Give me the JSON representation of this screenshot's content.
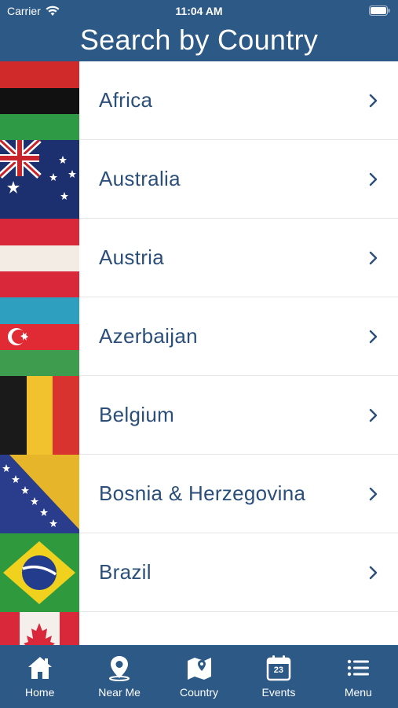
{
  "status_bar": {
    "carrier": "Carrier",
    "time": "11:04 AM"
  },
  "header": {
    "title": "Search by Country"
  },
  "countries": [
    {
      "label": "Africa",
      "flag": "africa-flag"
    },
    {
      "label": "Australia",
      "flag": "australia-flag"
    },
    {
      "label": "Austria",
      "flag": "austria-flag"
    },
    {
      "label": "Azerbaijan",
      "flag": "azerbaijan-flag"
    },
    {
      "label": "Belgium",
      "flag": "belgium-flag"
    },
    {
      "label": "Bosnia & Herzegovina",
      "flag": "bosnia-flag"
    },
    {
      "label": "Brazil",
      "flag": "brazil-flag"
    },
    {
      "label": "",
      "flag": "canada-flag"
    }
  ],
  "tabbar": {
    "home": "Home",
    "near_me": "Near Me",
    "country": "Country",
    "events": "Events",
    "events_date": "23",
    "menu": "Menu"
  },
  "colors": {
    "brand": "#2d5987",
    "label": "#2b4f7a"
  }
}
